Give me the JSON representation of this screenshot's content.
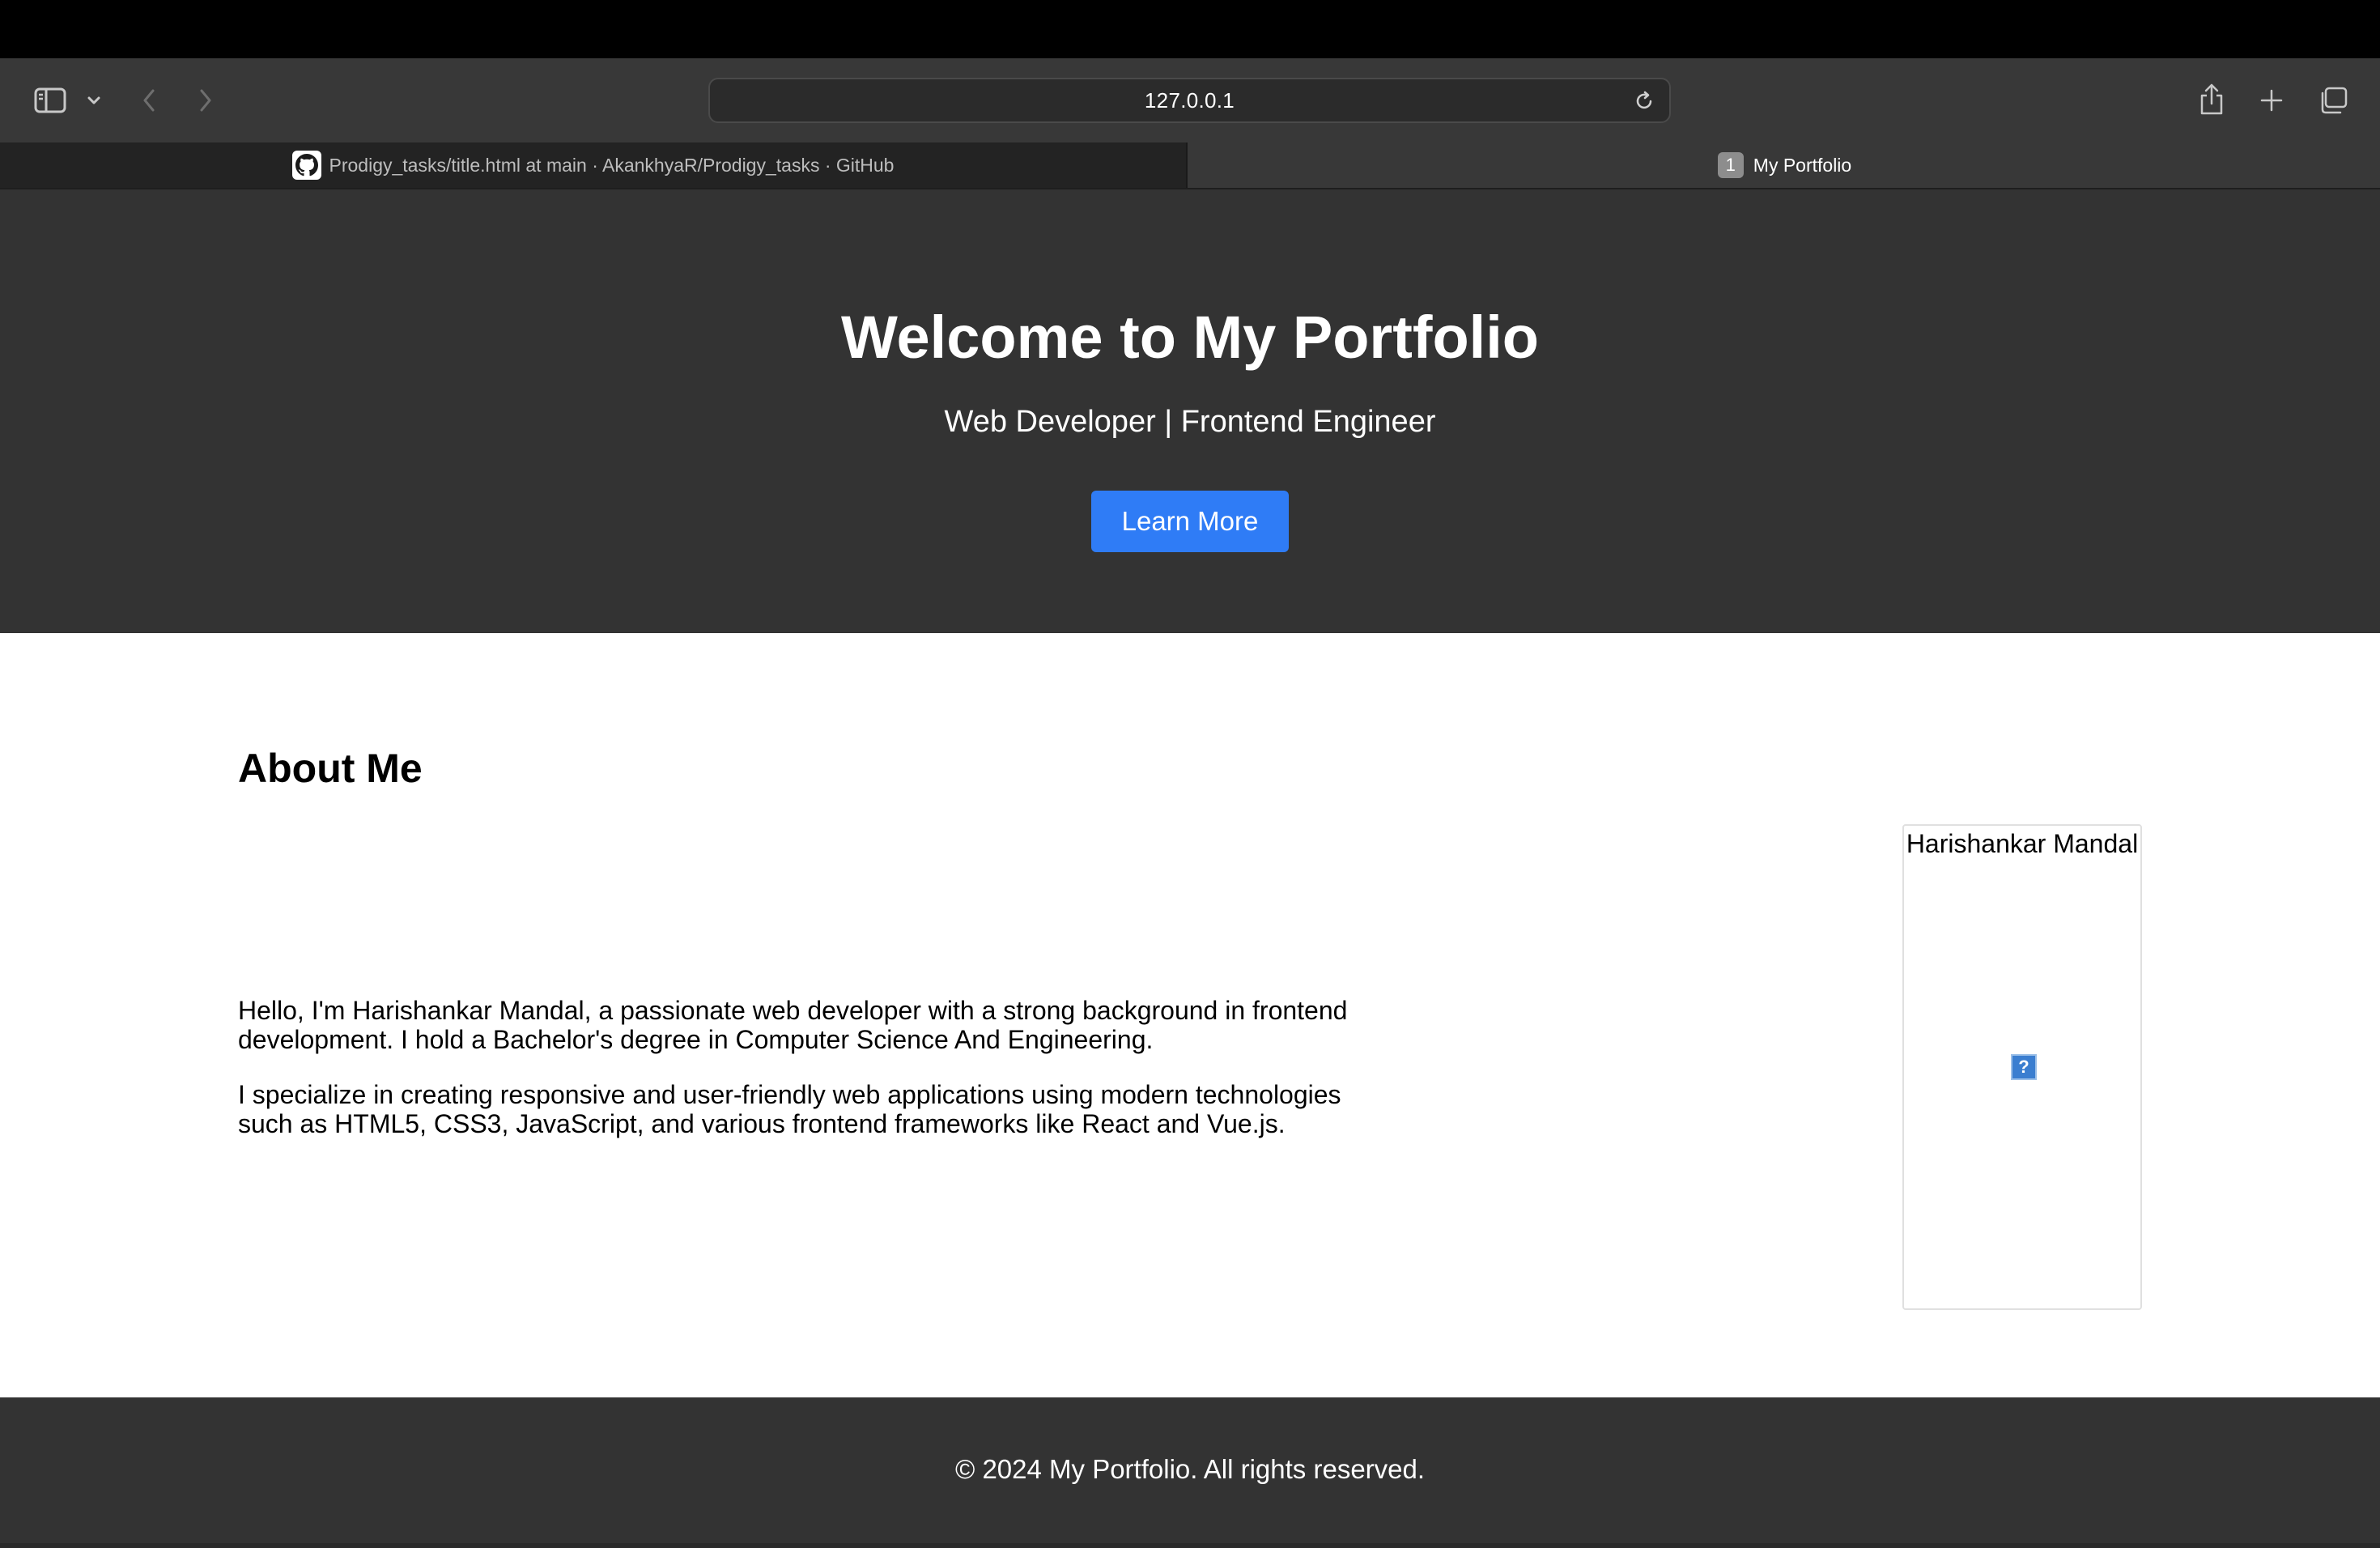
{
  "browser": {
    "url": "127.0.0.1",
    "tabs": [
      {
        "label": "Prodigy_tasks/title.html at main · AkankhyaR/Prodigy_tasks · GitHub",
        "active": false,
        "icon": "github-icon"
      },
      {
        "label": "My Portfolio",
        "active": true,
        "badge": "1"
      }
    ],
    "toolbar_icons": [
      "sidebar-icon",
      "chevron-down-icon",
      "back-arrow-icon",
      "forward-arrow-icon",
      "reload-icon",
      "share-icon",
      "plus-icon",
      "tabs-overview-icon"
    ]
  },
  "hero": {
    "title": "Welcome to My Portfolio",
    "subtitle": "Web Developer | Frontend Engineer",
    "button_label": "Learn More",
    "button_color": "#2f7cf6",
    "background": "#333333"
  },
  "about": {
    "title": "About Me",
    "paragraphs": [
      "Hello, I'm Harishankar Mandal, a passionate web developer with a strong background in frontend development. I hold a Bachelor's degree in Computer Science And Engineering.",
      "I specialize in creating responsive and user-friendly web applications using modern technologies such as HTML5, CSS3, JavaScript, and various frontend frameworks like React and Vue.js."
    ],
    "profile_name": "Harishankar Mandal",
    "profile_image_icon": "broken-image-icon"
  },
  "footer": {
    "text": "© 2024 My Portfolio. All rights reserved."
  }
}
